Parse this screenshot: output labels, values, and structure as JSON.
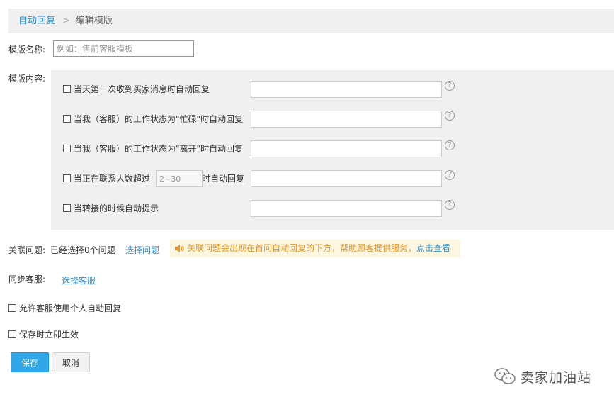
{
  "breadcrumb": {
    "parent": "自动回复",
    "separator": ">",
    "current": "编辑模版"
  },
  "template_name": {
    "label": "模版名称:",
    "placeholder": "例如：售前客服模板",
    "value": ""
  },
  "content": {
    "label": "模版内容:",
    "options": [
      {
        "label": "当天第一次收到买家消息时自动回复",
        "help": "?"
      },
      {
        "label": "当我（客服）的工作状态为\"忙碌\"时自动回复",
        "help": "?"
      },
      {
        "label": "当我（客服）的工作状态为\"离开\"时自动回复",
        "help": "?"
      },
      {
        "label": "当正在联系人数超过",
        "inline_placeholder": "2~30",
        "label_after": "时自动回复",
        "help": "?"
      },
      {
        "label": "当转接的时候自动提示",
        "help": "?"
      }
    ]
  },
  "related": {
    "label": "关联问题:",
    "status": "已经选择0个问题",
    "select_link": "选择问题",
    "notice_text": "关联问题会出现在首问自动回复的下方，帮助顾客提供服务，",
    "notice_link": "点击查看"
  },
  "sync": {
    "label": "同步客服:",
    "select_link": "选择客服"
  },
  "allow_personal": {
    "label": "允许客服使用个人自动回复"
  },
  "save_immediate": {
    "label": "保存时立即生效"
  },
  "buttons": {
    "save": "保存",
    "cancel": "取消"
  },
  "watermark": {
    "text": "卖家加油站",
    "icon": "wechat-icon"
  },
  "colors": {
    "link": "#2f8fd0",
    "primary_button": "#2fa6e8",
    "notice_bg": "#fdf6e0",
    "notice_text": "#e0962d",
    "panel_bg": "#f0f0f0"
  }
}
